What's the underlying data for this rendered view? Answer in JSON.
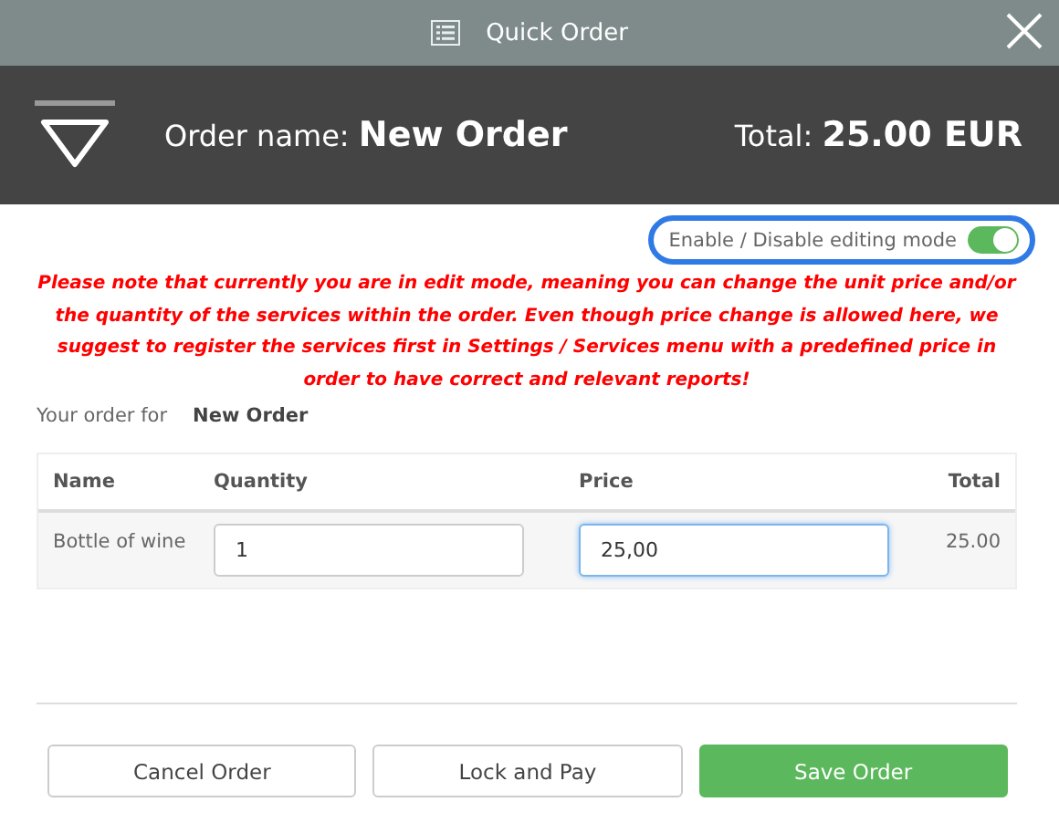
{
  "window": {
    "title": "Quick Order"
  },
  "header": {
    "name_label": "Order name:",
    "name": "New Order",
    "total_label": "Total:",
    "total": "25.00 EUR"
  },
  "edit_toggle": {
    "label": "Enable / Disable editing mode",
    "on": true
  },
  "warning": "Please note that currently you are in edit mode, meaning you can change the unit price and/or the quantity of the services within the order. Even though price change is allowed here, we suggest to register the services first in Settings / Services menu with a predefined price in order to have correct and relevant reports!",
  "order_for": {
    "label": "Your order for",
    "name": "New Order"
  },
  "table": {
    "columns": [
      "Name",
      "Quantity",
      "Price",
      "Total"
    ],
    "rows": [
      {
        "name": "Bottle of wine",
        "quantity": {
          "value": "1",
          "focused": false
        },
        "price": {
          "value": "25,00",
          "focused": true
        },
        "total": "25.00"
      }
    ]
  },
  "buttons": [
    {
      "label": "Cancel Order",
      "kind": "secondary"
    },
    {
      "label": "Lock and Pay",
      "kind": "secondary"
    },
    {
      "label": "Save Order",
      "kind": "primary"
    }
  ]
}
